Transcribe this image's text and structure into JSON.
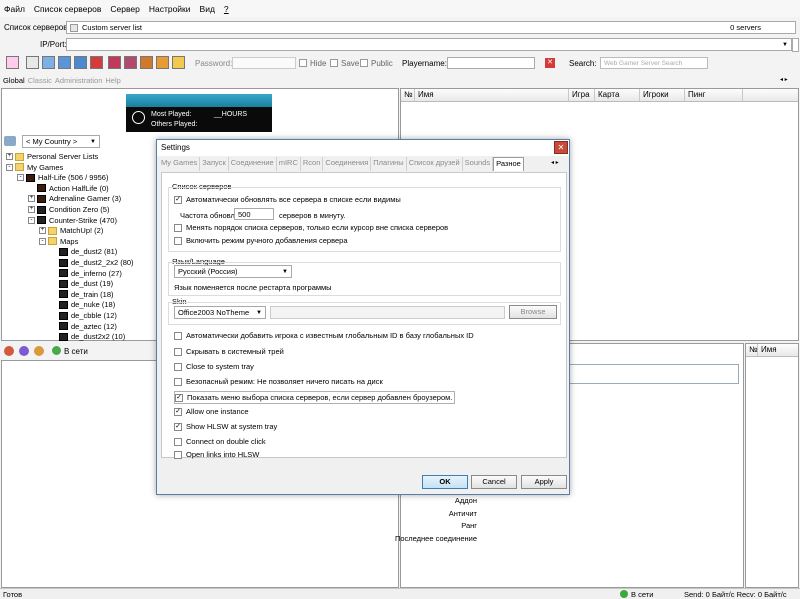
{
  "menu": [
    "Файл",
    "Список серверов",
    "Сервер",
    "Настройки",
    "Вид",
    "?"
  ],
  "server_list": {
    "label": "Список серверов:",
    "value": "Custom server list",
    "count": "0 servers"
  },
  "ipport": {
    "label": "IP/Port:"
  },
  "filters": {
    "password_label": "Password:",
    "hide": "Hide",
    "save": "Save",
    "public": "Public",
    "playername_label": "Playername:",
    "search_label": "Search:",
    "search_placeholder": "Web Gamer Server Search"
  },
  "tabs": [
    "Global",
    "Classic",
    "Administration",
    "Help"
  ],
  "banner": {
    "most_played": "Most Played:",
    "hours": "__HOURS",
    "others_played": "Others Played:"
  },
  "country": "< My Country >",
  "tree": [
    {
      "label": "Personal Server Lists",
      "indent": 0,
      "type": "folder",
      "pm": "+"
    },
    {
      "label": "My Games",
      "indent": 0,
      "type": "folder",
      "pm": "-"
    },
    {
      "label": "Half-Life (506 / 9956)",
      "indent": 1,
      "type": "hl",
      "pm": "-"
    },
    {
      "label": "Action HalfLife (0)",
      "indent": 2,
      "type": "hl",
      "pm": ""
    },
    {
      "label": "Adrenaline Gamer (3)",
      "indent": 2,
      "type": "hl",
      "pm": "+"
    },
    {
      "label": "Condition Zero (5)",
      "indent": 2,
      "type": "cs",
      "pm": "+"
    },
    {
      "label": "Counter-Strike (470)",
      "indent": 2,
      "type": "cs",
      "pm": "-"
    },
    {
      "label": "MatchUp! (2)",
      "indent": 3,
      "type": "folder",
      "pm": "+"
    },
    {
      "label": "Maps",
      "indent": 3,
      "type": "folder",
      "pm": "-"
    },
    {
      "label": "de_dust2 (81)",
      "indent": 4,
      "type": "cs",
      "pm": ""
    },
    {
      "label": "de_dust2_2x2 (80)",
      "indent": 4,
      "type": "cs",
      "pm": ""
    },
    {
      "label": "de_inferno (27)",
      "indent": 4,
      "type": "cs",
      "pm": ""
    },
    {
      "label": "de_dust (19)",
      "indent": 4,
      "type": "cs",
      "pm": ""
    },
    {
      "label": "de_train (18)",
      "indent": 4,
      "type": "cs",
      "pm": ""
    },
    {
      "label": "de_nuke (18)",
      "indent": 4,
      "type": "cs",
      "pm": ""
    },
    {
      "label": "de_cbble (12)",
      "indent": 4,
      "type": "cs",
      "pm": ""
    },
    {
      "label": "de_aztec (12)",
      "indent": 4,
      "type": "cs",
      "pm": ""
    },
    {
      "label": "de_dust2x2 (10)",
      "indent": 4,
      "type": "cs",
      "pm": ""
    }
  ],
  "server_columns": [
    "№",
    "Имя",
    "Игра",
    "Карта",
    "Игроки",
    "Пинг"
  ],
  "players_columns": [
    "№",
    "Имя"
  ],
  "online": "В сети",
  "info_labels": [
    "Аддон",
    "Античит",
    "Ранг",
    "Последнее соединение"
  ],
  "dialog": {
    "title": "Settings",
    "tabs": [
      "My Games",
      "Запуск",
      "Соединение",
      "mIRC",
      "Rcon",
      "Соединения",
      "Плагины",
      "Список друзей",
      "Sounds",
      "Разное"
    ],
    "g1_label": "Список серверов",
    "auto_refresh": "Автоматически обновлять все сервера в списке если видимы",
    "refresh_rate_label": "Частота обновл.",
    "refresh_rate_value": "500",
    "refresh_rate_unit": "серверов в минуту.",
    "reorder": "Менять порядок списка серверов, только если курсор вне списка серверов",
    "manual_add": "Включить режим ручного добавления сервера",
    "lang_label": "Язык/Language",
    "lang_value": "Русский (Россия)",
    "lang_note": "Язык поменяется после рестарта программы",
    "skin_label": "Skin",
    "skin_value": "Office2003 NoTheme",
    "browse": "Browse",
    "auto_add_player": "Автоматически добавить игрока с известным глобальным ID в базу глобальных ID",
    "hide_tray": "Скрывать в системный трей",
    "close_tray": "Close to system tray",
    "safe_mode": "Безопасный режим: Не позволяет ничего писать на диск",
    "show_menu": "Показать меню выбора списка серверов, если сервер добавлен броузером.",
    "allow_one": "Allow one instance",
    "show_hlsw": "Show HLSW at system tray",
    "connect_dbl": "Connect on double click",
    "open_links": "Open links into HLSW",
    "ok": "OK",
    "cancel": "Cancel",
    "apply": "Apply"
  },
  "status": {
    "ready": "Готов",
    "online": "В сети",
    "traffic": "Send: 0 Байт/с  Recv: 0 Байт/с"
  }
}
